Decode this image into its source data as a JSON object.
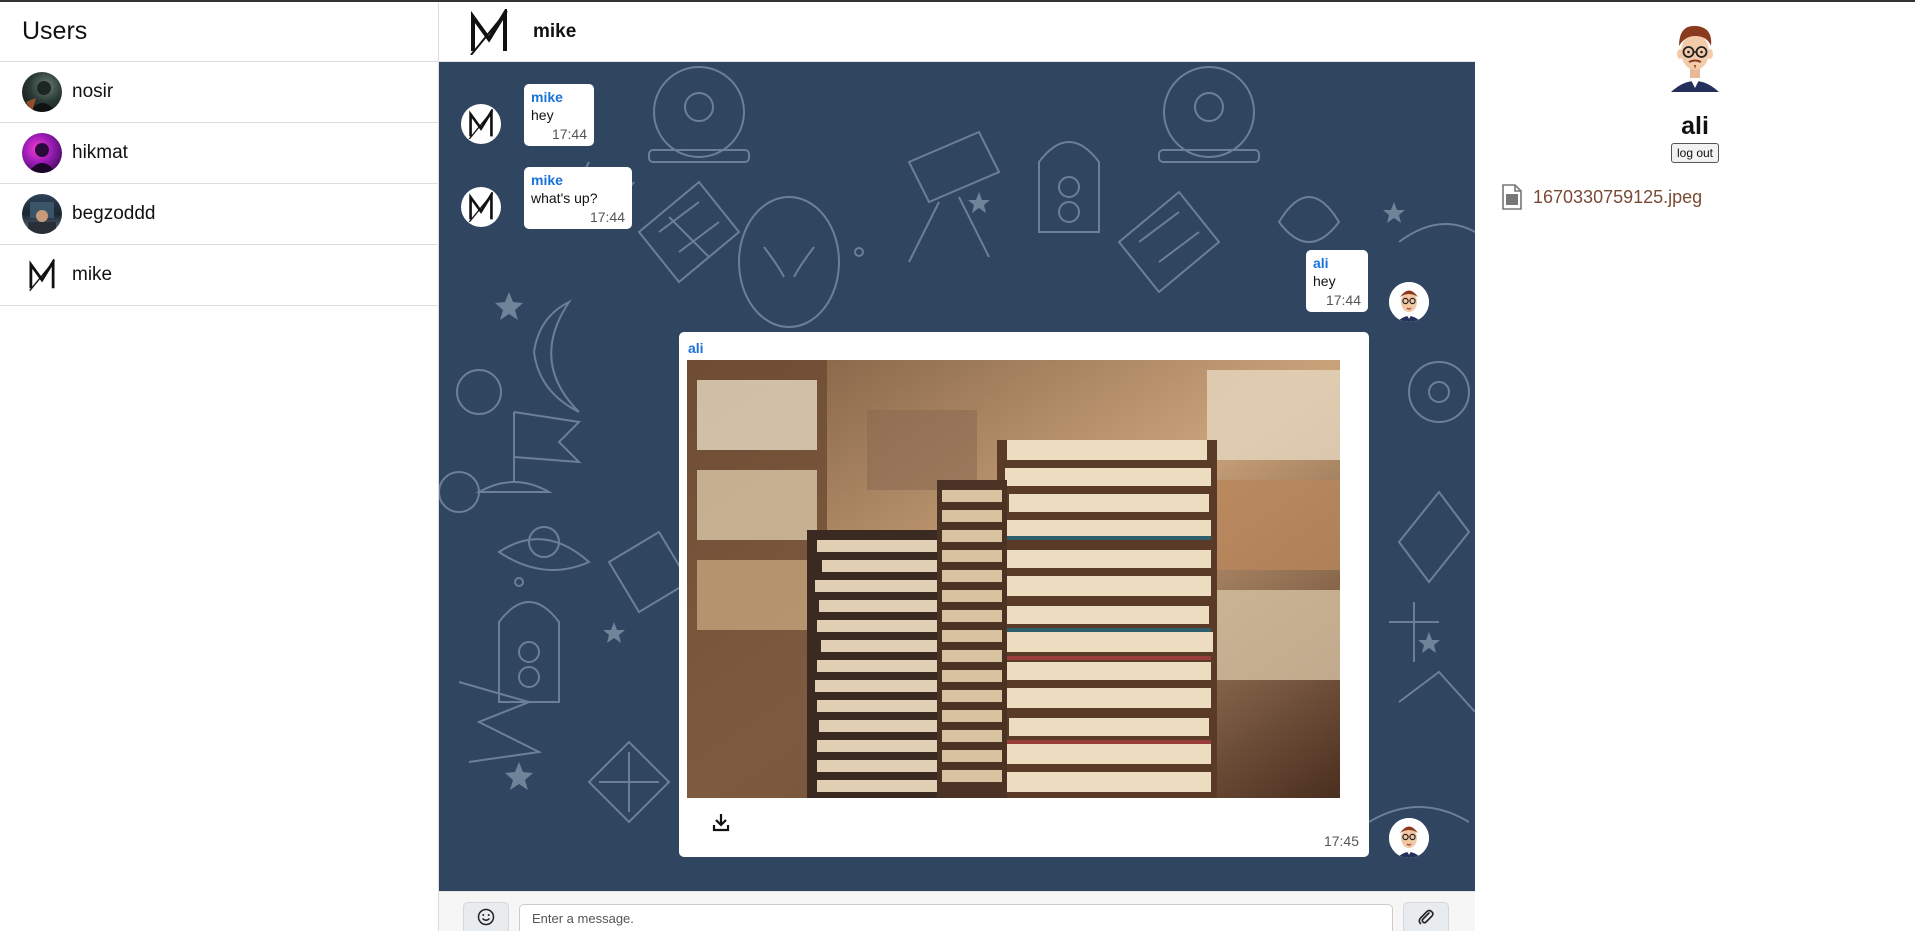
{
  "sidebar": {
    "title": "Users",
    "users": [
      {
        "name": "nosir",
        "avatar": "photo-avatar"
      },
      {
        "name": "hikmat",
        "avatar": "photo-avatar"
      },
      {
        "name": "begzoddd",
        "avatar": "photo-avatar"
      },
      {
        "name": "mike",
        "avatar": "m-logo-avatar"
      }
    ]
  },
  "chat": {
    "title": "mike",
    "messages": [
      {
        "sender": "mike",
        "text": "hey",
        "time": "17:44"
      },
      {
        "sender": "mike",
        "text": "what's up?",
        "time": "17:44"
      },
      {
        "sender": "ali",
        "text": "hey",
        "time": "17:44"
      },
      {
        "sender": "ali",
        "type": "image",
        "time": "17:45",
        "image": "books-stack-photo"
      }
    ],
    "composer": {
      "placeholder": "Enter a message.",
      "emoji_icon": "smile-icon",
      "attach_icon": "paperclip-icon"
    },
    "background_color": "#2f4560",
    "sender_color": "#1a73d9"
  },
  "profile": {
    "name": "ali",
    "logout_label": "log out",
    "files": [
      {
        "name": "1670330759125.jpeg",
        "icon": "file-icon"
      }
    ],
    "file_color": "#7a4a34"
  }
}
